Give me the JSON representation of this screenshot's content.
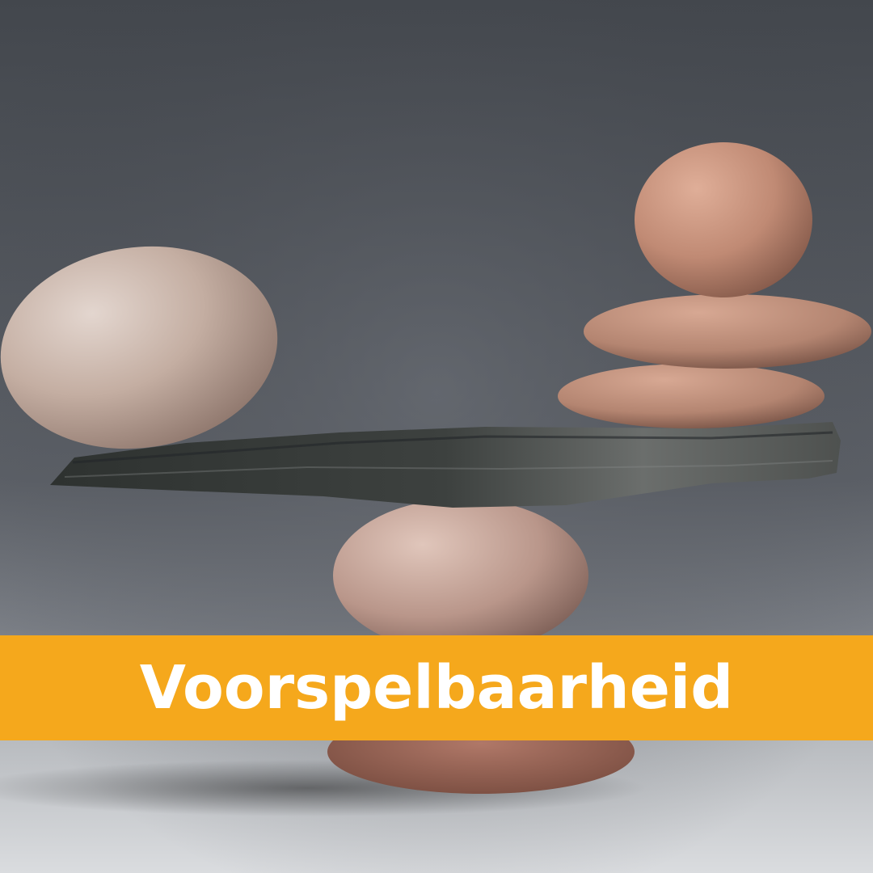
{
  "image": {
    "subject": "balanced-stones",
    "background_color": "#52565c",
    "floor_color": "#d6d8db"
  },
  "banner": {
    "label": "Voorspelbaarheid",
    "background_color": "#f5a81c",
    "text_color": "#ffffff"
  }
}
